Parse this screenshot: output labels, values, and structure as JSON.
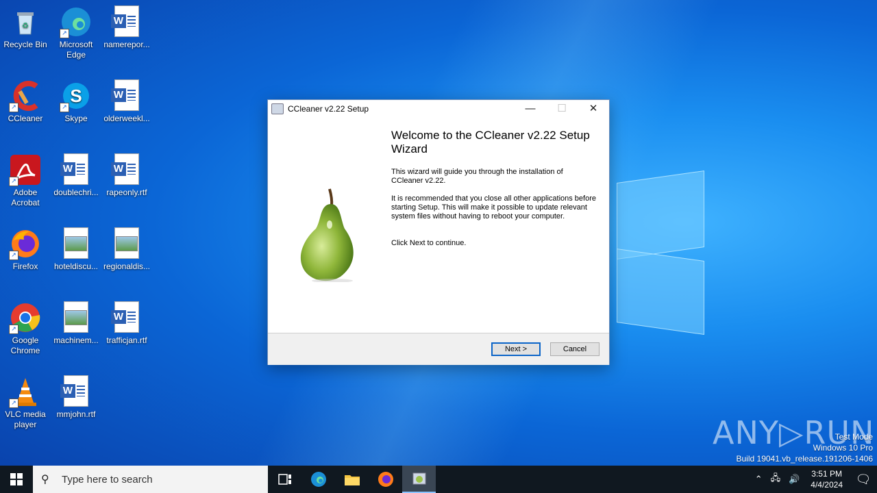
{
  "desktop": {
    "icons": [
      {
        "label": "Recycle Bin"
      },
      {
        "label": "Microsoft Edge"
      },
      {
        "label": "namerepor..."
      },
      {
        "label": "CCleaner"
      },
      {
        "label": "Skype"
      },
      {
        "label": "olderweekl..."
      },
      {
        "label": "Adobe Acrobat"
      },
      {
        "label": "doublechri..."
      },
      {
        "label": "rapeonly.rtf"
      },
      {
        "label": "Firefox"
      },
      {
        "label": "hoteldiscu..."
      },
      {
        "label": "regionaldis..."
      },
      {
        "label": "Google Chrome"
      },
      {
        "label": "machinem..."
      },
      {
        "label": "trafficjan.rtf"
      },
      {
        "label": "VLC media player"
      },
      {
        "label": "mmjohn.rtf"
      }
    ]
  },
  "dialog": {
    "title": "CCleaner v2.22 Setup",
    "minimize": "—",
    "maximize": "☐",
    "close": "✕",
    "heading": "Welcome to the CCleaner v2.22 Setup Wizard",
    "para1": "This wizard will guide you through the installation of CCleaner v2.22.",
    "para2": "It is recommended that you close all other applications before starting Setup. This will make it possible to update relevant system files without having to reboot your computer.",
    "para3": "Click Next to continue.",
    "next_label": "Next >",
    "cancel_label": "Cancel"
  },
  "watermark": {
    "brand": "ANY▷RUN",
    "line1": "Test Mode",
    "line2": "Windows 10 Pro",
    "line3": "Build 19041.vb_release.191206-1406"
  },
  "taskbar": {
    "search_placeholder": "Type here to search",
    "time": "3:51 PM",
    "date": "4/4/2024"
  }
}
